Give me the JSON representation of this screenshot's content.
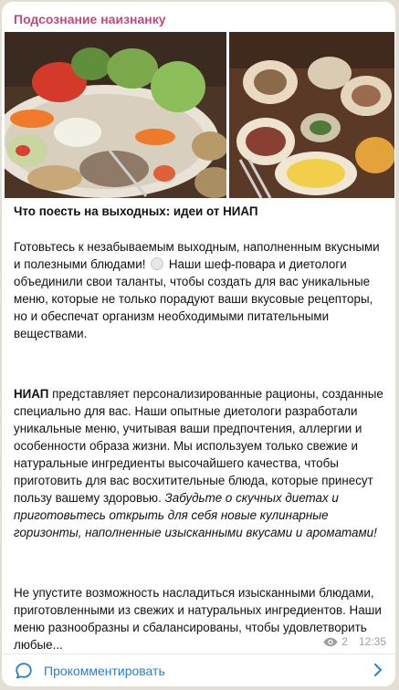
{
  "channel": {
    "name": "Подсознание наизнанку"
  },
  "photos": [
    {
      "name": "vegetables-platter-photo"
    },
    {
      "name": "dinner-table-photo"
    }
  ],
  "post": {
    "title": "Что поесть на выходных: идеи от НИАП",
    "p1_before_emoji": "Готовьтесь к незабываемым выходным, наполненным вкусными и полезными блюдами! ",
    "p1_after_emoji": " Наши шеф-повара и диетологи объединили свои таланты, чтобы создать для вас уникальные меню, которые не только порадуют ваши вкусовые рецепторы, но и обеспечат организм необходимыми питательными веществами.",
    "p2_bold": "НИАП",
    "p2_text": " представляет персонализированные рационы, созданные специально для вас. Наши опытные диетологи разработали уникальные меню, учитывая ваши предпочтения, аллергии и особенности образа жизни. Мы используем только свежие и натуральные ингредиенты высочайшего качества, чтобы приготовить для вас восхитительные блюда, которые принесут пользу вашему здоровью. ",
    "p2_italic": "Забудьте о скучных диетах и приготовьтесь открыть для себя новые кулинарные горизонты, наполненные изысканными вкусами и ароматами!",
    "p3": "Не упустите возможность насладиться изысканными блюдами, приготовленными из свежих и натуральных ингредиентов. Наши меню разнообразны и сбалансированы, чтобы удовлетворить любые..."
  },
  "meta": {
    "views": "2",
    "time": "12:35"
  },
  "comment": {
    "label": "Прокомментировать"
  },
  "icons": {
    "plate": "plate-with-cutlery-emoji",
    "views": "eye-icon",
    "comment": "comment-bubble-icon",
    "chevron": "chevron-right-icon"
  },
  "colors": {
    "channel_name": "#c4497a",
    "link": "#2481cc",
    "meta": "#a0a0a0"
  }
}
